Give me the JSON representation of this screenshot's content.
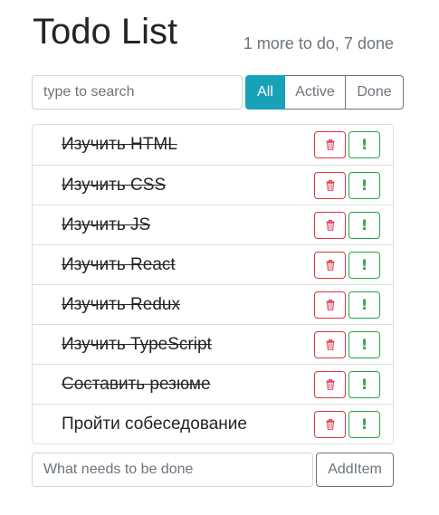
{
  "header": {
    "title": "Todo List",
    "status": "1 more to do, 7 done"
  },
  "search": {
    "placeholder": "type to search",
    "value": ""
  },
  "filters": [
    {
      "label": "All",
      "active": true
    },
    {
      "label": "Active",
      "active": false
    },
    {
      "label": "Done",
      "active": false
    }
  ],
  "todos": [
    {
      "label": "Изучить HTML",
      "done": true
    },
    {
      "label": "Изучить CSS",
      "done": true
    },
    {
      "label": "Изучить JS",
      "done": true
    },
    {
      "label": "Изучить React",
      "done": true
    },
    {
      "label": "Изучить Redux",
      "done": true
    },
    {
      "label": "Изучить TypeScript",
      "done": true
    },
    {
      "label": "Составить резюме",
      "done": true
    },
    {
      "label": "Пройти собеседование",
      "done": false
    }
  ],
  "item_actions": {
    "delete_icon": "trash-icon",
    "important_icon": "exclamation-icon",
    "important_glyph": "!"
  },
  "add_form": {
    "placeholder": "What needs to be done",
    "value": "",
    "button_label": "AddItem"
  },
  "colors": {
    "accent": "#17a2b8",
    "danger": "#dc3545",
    "success": "#28a745",
    "muted": "#6c757d",
    "text": "#212529",
    "border": "#dfdfdf"
  }
}
